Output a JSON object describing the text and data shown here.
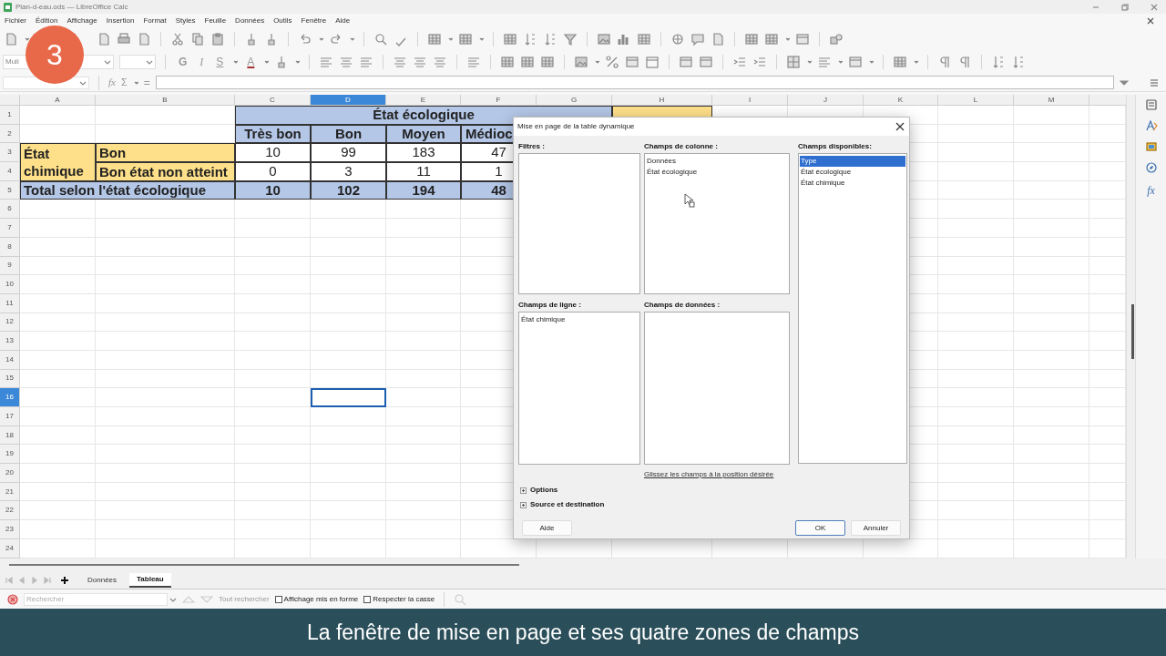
{
  "window": {
    "title": "Plan-d-eau.ods — LibreOffice Calc"
  },
  "menu": [
    "Fichier",
    "Édition",
    "Affichage",
    "Insertion",
    "Format",
    "Styles",
    "Feuille",
    "Données",
    "Outils",
    "Fenêtre",
    "Aide"
  ],
  "step_badge": "3",
  "format_toolbar": {
    "font_name": "Muli",
    "format_buttons": [
      {
        "text": "G",
        "kind": "bold"
      },
      {
        "text": "I",
        "kind": "italic"
      },
      {
        "text": "S",
        "kind": "shadow"
      },
      {
        "text": "A",
        "kind": "font_color"
      }
    ]
  },
  "formula_bar": {
    "function_wizard": "fx",
    "sum": "Σ",
    "equals": "="
  },
  "sidebar": {
    "functions": "fx"
  },
  "sheet": {
    "columns": [
      {
        "label": "A",
        "selected": false
      },
      {
        "label": "B",
        "selected": false
      },
      {
        "label": "C",
        "selected": false
      },
      {
        "label": "D",
        "selected": true
      },
      {
        "label": "E",
        "selected": false
      },
      {
        "label": "F",
        "selected": false
      },
      {
        "label": "G",
        "selected": false
      },
      {
        "label": "H",
        "selected": false
      },
      {
        "label": "I",
        "selected": false
      },
      {
        "label": "J",
        "selected": false
      },
      {
        "label": "K",
        "selected": false
      },
      {
        "label": "L",
        "selected": false
      },
      {
        "label": "M",
        "selected": false
      }
    ],
    "rows": [
      {
        "label": "1",
        "selected": false
      },
      {
        "label": "2",
        "selected": false
      },
      {
        "label": "3",
        "selected": false
      },
      {
        "label": "4",
        "selected": false
      },
      {
        "label": "5",
        "selected": false
      },
      {
        "label": "6",
        "selected": false
      },
      {
        "label": "7",
        "selected": false
      },
      {
        "label": "8",
        "selected": false
      },
      {
        "label": "9",
        "selected": false
      },
      {
        "label": "10",
        "selected": false
      },
      {
        "label": "11",
        "selected": false
      },
      {
        "label": "12",
        "selected": false
      },
      {
        "label": "13",
        "selected": false
      },
      {
        "label": "14",
        "selected": false
      },
      {
        "label": "15",
        "selected": false
      },
      {
        "label": "16",
        "selected": true
      },
      {
        "label": "17",
        "selected": false
      },
      {
        "label": "18",
        "selected": false
      },
      {
        "label": "19",
        "selected": false
      },
      {
        "label": "20",
        "selected": false
      },
      {
        "label": "21",
        "selected": false
      },
      {
        "label": "22",
        "selected": false
      },
      {
        "label": "23",
        "selected": false
      },
      {
        "label": "24",
        "selected": false
      }
    ],
    "table": [
      [
        {
          "kind": "blank"
        },
        {
          "kind": "blank"
        },
        {
          "text": "État écologique",
          "kind": "heading_wide"
        },
        {
          "kind": "highlight_tall"
        }
      ],
      [
        {
          "kind": "blank"
        },
        {
          "kind": "blank"
        },
        {
          "text": "Très bon",
          "kind": "heading"
        },
        {
          "text": "Bon",
          "kind": "heading"
        },
        {
          "text": "Moyen",
          "kind": "heading"
        },
        {
          "text": "Médioc",
          "kind": "heading_left"
        }
      ],
      [
        {
          "text": "État chimique",
          "kind": "label_tall"
        },
        {
          "text": "Bon",
          "kind": "label"
        },
        {
          "text": "10",
          "kind": "value"
        },
        {
          "text": "99",
          "kind": "value"
        },
        {
          "text": "183",
          "kind": "value"
        },
        {
          "text": "47",
          "kind": "value"
        }
      ],
      [
        {
          "text": "Bon état non atteint",
          "kind": "label"
        },
        {
          "text": "0",
          "kind": "value"
        },
        {
          "text": "3",
          "kind": "value"
        },
        {
          "text": "11",
          "kind": "value"
        },
        {
          "text": "1",
          "kind": "value"
        }
      ],
      [
        {
          "text": "Total selon l'état écologique",
          "kind": "total"
        },
        {
          "text": "10",
          "kind": "total_value"
        },
        {
          "text": "102",
          "kind": "total_value"
        },
        {
          "text": "194",
          "kind": "total_value"
        },
        {
          "text": "48",
          "kind": "total_value"
        }
      ]
    ]
  },
  "sheet_tabs": [
    {
      "label": "Données",
      "selected": false
    },
    {
      "label": "Tableau",
      "selected": true
    }
  ],
  "find_bar": {
    "placeholder": "Rechercher",
    "find_all": "Tout rechercher",
    "options": [
      {
        "label": "Affichage mis en forme",
        "checked": false
      },
      {
        "label": "Respecter la casse",
        "checked": false
      }
    ]
  },
  "dialog": {
    "title": "Mise en page de la table dynamique",
    "filters": {
      "label": "Filtres :"
    },
    "column_fields": {
      "label": "Champs de colonne :",
      "items": [
        "Données",
        "État écologique"
      ]
    },
    "row_fields": {
      "label": "Champs de ligne :",
      "items": [
        "État chimique"
      ]
    },
    "data_fields": {
      "label": "Champs de données :"
    },
    "available_fields": {
      "label": "Champs disponibles:",
      "items": [
        {
          "text": "Type",
          "selected": true
        },
        {
          "text": "État écologique",
          "selected": false
        },
        {
          "text": "État chimique",
          "selected": false
        }
      ]
    },
    "hint": "Glissez les champs à la position désirée",
    "expanders": [
      {
        "label": "Options",
        "expanded": false
      },
      {
        "label": "Source et destination",
        "expanded": false
      }
    ],
    "buttons": [
      {
        "label": "Aide",
        "default": false
      },
      {
        "label": "OK",
        "default": true
      },
      {
        "label": "Annuler",
        "default": false
      }
    ]
  },
  "caption": "La fenêtre de mise en page et ses quatre zones de champs"
}
